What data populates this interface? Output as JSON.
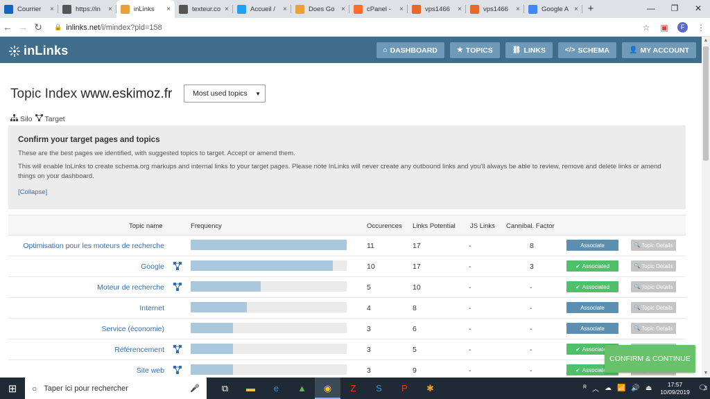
{
  "browser": {
    "tabs": [
      {
        "label": "Courrier",
        "favicon": "outlook-icon",
        "color": "#1565c0",
        "active": false
      },
      {
        "label": "https://in",
        "favicon": "globe-icon",
        "color": "#555555",
        "active": false
      },
      {
        "label": "inLinks",
        "favicon": "inlinks-icon",
        "color": "#e9a23b",
        "active": true
      },
      {
        "label": "texteur.co",
        "favicon": "globe-icon",
        "color": "#555555",
        "active": false
      },
      {
        "label": "Accueil /",
        "favicon": "twitter-icon",
        "color": "#1da1f2",
        "active": false
      },
      {
        "label": "Does Go",
        "favicon": "inlinks-icon",
        "color": "#e9a23b",
        "active": false
      },
      {
        "label": "cPanel - ",
        "favicon": "cpanel-icon",
        "color": "#ff6c2c",
        "active": false
      },
      {
        "label": "vps1466",
        "favicon": "vps-icon",
        "color": "#e8672a",
        "active": false
      },
      {
        "label": "vps1466",
        "favicon": "vps-icon",
        "color": "#e8672a",
        "active": false
      },
      {
        "label": "Google A",
        "favicon": "google-analytics-icon",
        "color": "#4285f4",
        "active": false
      }
    ],
    "url_host": "inlinks.net",
    "url_path": "/i/mindex?pid=158",
    "profile_initial": "F"
  },
  "app": {
    "logo": "inLinks",
    "nav": [
      {
        "label": "DASHBOARD",
        "icon": "⌂",
        "name": "nav-dashboard-button",
        "icon_name": "home-icon"
      },
      {
        "label": "TOPICS",
        "icon": "★",
        "name": "nav-topics-button",
        "icon_name": "star-icon"
      },
      {
        "label": "LINKS",
        "icon": "⛓",
        "name": "nav-links-button",
        "icon_name": "link-icon"
      },
      {
        "label": "SCHEMA",
        "icon": "</>",
        "name": "nav-schema-button",
        "icon_name": "code-icon"
      },
      {
        "label": "MY ACCOUNT",
        "icon": "👤",
        "name": "nav-account-button",
        "icon_name": "user-icon"
      }
    ],
    "accent_color": "#3f6d8a"
  },
  "page": {
    "title_prefix": "Topic Index",
    "site": "www.eskimoz.fr",
    "sort_value": "Most used topics",
    "legend_silo": "Silo",
    "legend_target": "Target"
  },
  "info": {
    "heading": "Confirm your target pages and topics",
    "line1": "These are the best pages we identified, with suggested topics to target. Accept or amend them.",
    "line2": "This will enable InLinks to create schema.org markups and internal links to your target pages. Please note InLinks will never create any outbound links and you'll always be able to review, remove and delete links or amend things on your dashboard.",
    "collapse": "[Collapse]"
  },
  "table": {
    "headers": {
      "topic_name": "Topic name",
      "frequency": "Frequency",
      "occurences": "Occurences",
      "links_potential": "Links Potential",
      "js_links": "JS Links",
      "cannibal": "Cannibal. Factor"
    },
    "details_label": "Topic Details",
    "rows": [
      {
        "name": "Optimisation pour les moteurs de recherche",
        "target": false,
        "frequency": 1.0,
        "occurences": "11",
        "links_potential": "17",
        "js_links": "-",
        "cannibal": "8",
        "status": "Associate",
        "associated": false
      },
      {
        "name": "Google",
        "target": true,
        "frequency": 0.91,
        "occurences": "10",
        "links_potential": "17",
        "js_links": "-",
        "cannibal": "3",
        "status": "Associated",
        "associated": true
      },
      {
        "name": "Moteur de recherche",
        "target": true,
        "frequency": 0.45,
        "occurences": "5",
        "links_potential": "10",
        "js_links": "-",
        "cannibal": "-",
        "status": "Associated",
        "associated": true
      },
      {
        "name": "Internet",
        "target": false,
        "frequency": 0.36,
        "occurences": "4",
        "links_potential": "8",
        "js_links": "-",
        "cannibal": "-",
        "status": "Associate",
        "associated": false
      },
      {
        "name": "Service (économie)",
        "target": false,
        "frequency": 0.27,
        "occurences": "3",
        "links_potential": "6",
        "js_links": "-",
        "cannibal": "-",
        "status": "Associate",
        "associated": false
      },
      {
        "name": "Référencement",
        "target": true,
        "frequency": 0.27,
        "occurences": "3",
        "links_potential": "5",
        "js_links": "-",
        "cannibal": "-",
        "status": "Associated",
        "associated": true
      },
      {
        "name": "Site web",
        "target": true,
        "frequency": 0.27,
        "occurences": "3",
        "links_potential": "9",
        "js_links": "-",
        "cannibal": "-",
        "status": "Associated",
        "associated": true
      }
    ]
  },
  "confirm_label": "CONFIRM & CONTINUE",
  "taskbar": {
    "search_placeholder": "Taper ici pour rechercher",
    "time": "17:57",
    "date": "10/09/2019",
    "notifications": "3"
  }
}
